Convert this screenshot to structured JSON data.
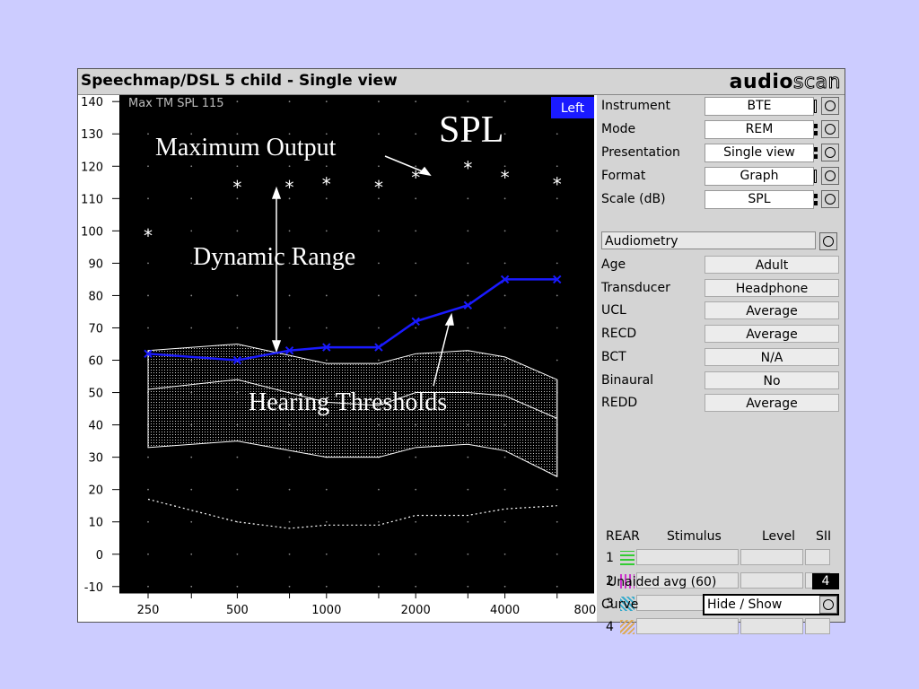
{
  "window": {
    "title": "Speechmap/DSL 5 child - Single view",
    "logo_bold": "audio",
    "logo_light": "scan"
  },
  "plot": {
    "header_note": "Max TM SPL 115",
    "side_tag": "Left",
    "annotations": {
      "scale": "SPL",
      "max_output": "Maximum Output",
      "dynamic_range": "Dynamic Range",
      "thresholds": "Hearing Thresholds"
    },
    "y_ticks": [
      "140",
      "130",
      "120",
      "110",
      "100",
      "90",
      "80",
      "70",
      "60",
      "50",
      "40",
      "30",
      "20",
      "10",
      "0",
      "-10"
    ],
    "x_ticks": [
      "250",
      "500",
      "1000",
      "2000",
      "4000",
      "8000"
    ]
  },
  "chart_data": {
    "type": "line",
    "x_scale": "log",
    "xlim": [
      200,
      8000
    ],
    "ylim": [
      -12,
      142
    ],
    "x_ticks": [
      250,
      500,
      1000,
      2000,
      4000,
      8000
    ],
    "y_ticks": [
      140,
      130,
      120,
      110,
      100,
      90,
      80,
      70,
      60,
      50,
      40,
      30,
      20,
      10,
      0,
      -10
    ],
    "max_output": {
      "freqs": [
        250,
        500,
        750,
        1000,
        1500,
        2000,
        3000,
        4000,
        6000
      ],
      "values": [
        99,
        114,
        114,
        115,
        114,
        117,
        120,
        117,
        115
      ]
    },
    "thresholds": {
      "freqs": [
        250,
        500,
        750,
        1000,
        1500,
        2000,
        3000,
        4000,
        6000
      ],
      "values": [
        62,
        60,
        63,
        64,
        64,
        72,
        77,
        85,
        85
      ]
    },
    "speech_band": {
      "freqs": [
        250,
        500,
        1000,
        1500,
        2000,
        3000,
        4000,
        6000
      ],
      "upper": [
        63,
        65,
        59,
        59,
        62,
        63,
        61,
        54
      ],
      "middle": [
        51,
        54,
        47,
        46,
        50,
        50,
        49,
        42
      ],
      "lower": [
        33,
        35,
        30,
        30,
        33,
        34,
        32,
        24
      ]
    },
    "noise_floor": {
      "freqs": [
        250,
        500,
        750,
        1000,
        1500,
        2000,
        3000,
        4000,
        6000
      ],
      "values": [
        17,
        10,
        8,
        9,
        9,
        12,
        12,
        14,
        15
      ]
    },
    "colors": {
      "background": "#000000",
      "thresholds": "#1a1aff",
      "speech_band": "#ffffff",
      "grid_dots": "#888888"
    }
  },
  "panel": {
    "settings": [
      {
        "label": "Instrument",
        "value": "BTE",
        "mark": "bar"
      },
      {
        "label": "Mode",
        "value": "REM",
        "mark": "dots"
      },
      {
        "label": "Presentation",
        "value": "Single view",
        "mark": "dots"
      },
      {
        "label": "Format",
        "value": "Graph",
        "mark": "bar"
      },
      {
        "label": "Scale (dB)",
        "value": "SPL",
        "mark": "dots"
      }
    ],
    "audiometry_label": "Audiometry",
    "audiometry": [
      {
        "label": "Age",
        "value": "Adult"
      },
      {
        "label": "Transducer",
        "value": "Headphone"
      },
      {
        "label": "UCL",
        "value": "Average"
      },
      {
        "label": "RECD",
        "value": "Average"
      },
      {
        "label": "BCT",
        "value": "N/A"
      },
      {
        "label": "Binaural",
        "value": "No"
      },
      {
        "label": "REDD",
        "value": "Average"
      }
    ],
    "rear_headers": {
      "rear": "REAR",
      "stimulus": "Stimulus",
      "level": "Level",
      "sii": "SII"
    },
    "rear_rows": [
      {
        "num": "1",
        "color": "#33cc33"
      },
      {
        "num": "2",
        "color": "#cc33cc"
      },
      {
        "num": "3",
        "color": "#33aacc"
      },
      {
        "num": "4",
        "color": "#ddaa55"
      }
    ],
    "unaided_label": "Unaided avg (60)",
    "unaided_value": "4",
    "curve_label": "Curve",
    "curve_button": "Hide / Show"
  }
}
